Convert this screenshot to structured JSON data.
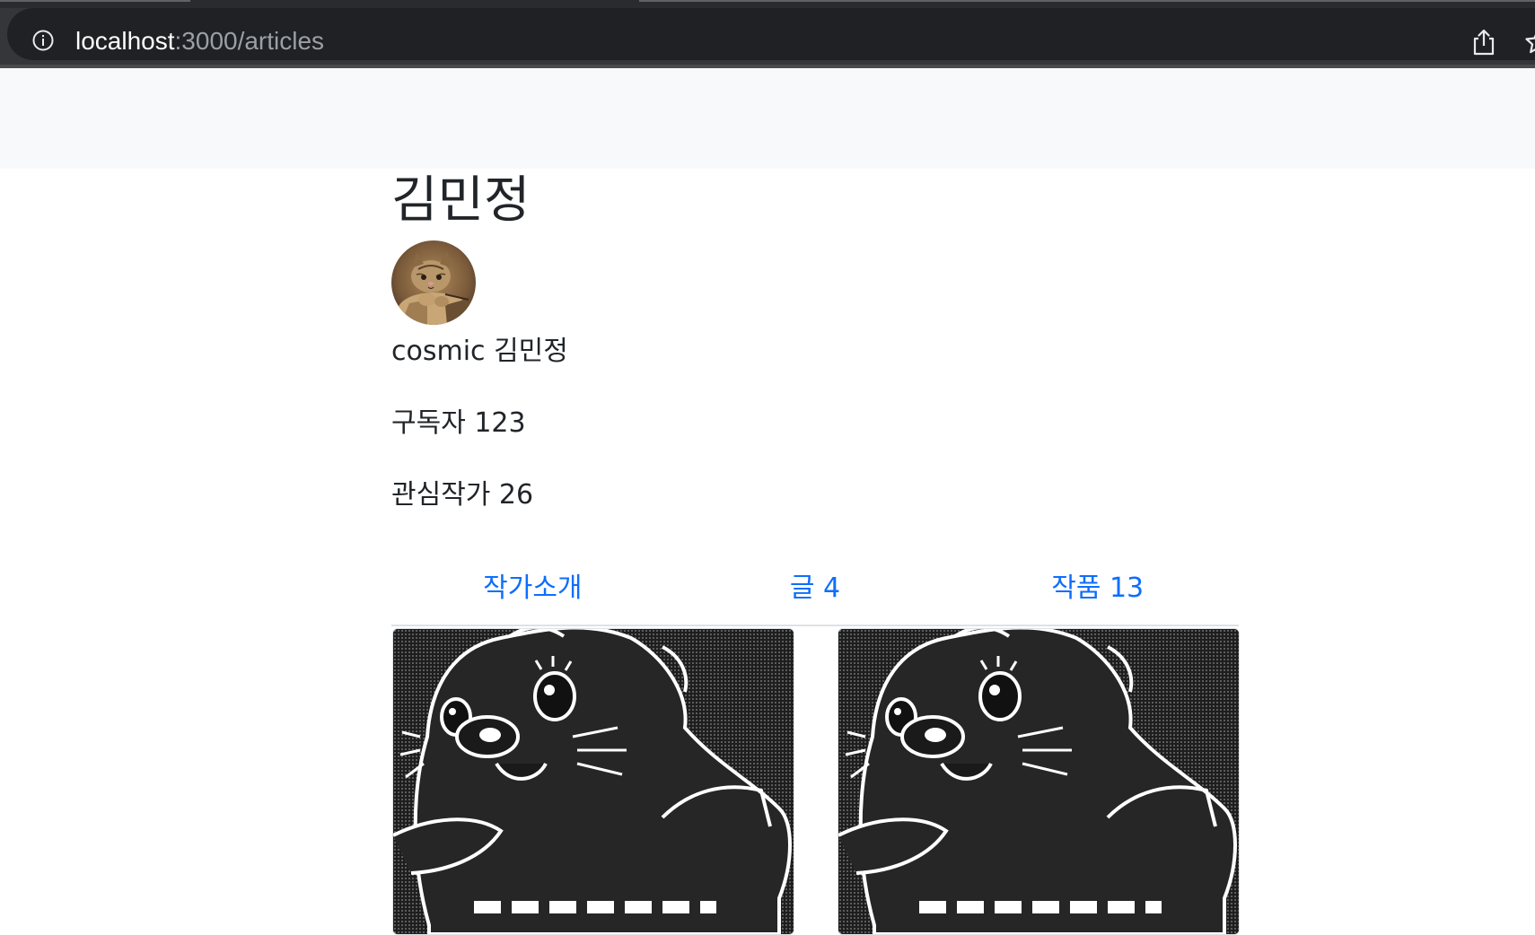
{
  "browser": {
    "url_host": "localhost",
    "url_path": ":3000/articles",
    "icons": [
      "info-icon",
      "share-icon",
      "star-icon"
    ]
  },
  "profile": {
    "name": "김민정",
    "avatar_icon": "cat-avatar",
    "description": "cosmic 김민정",
    "subscribers": "구독자 123",
    "following": "관심작가 26"
  },
  "tabs": [
    {
      "label": "작가소개"
    },
    {
      "label": "글 4"
    },
    {
      "label": "작품 13"
    }
  ],
  "colors": {
    "link": "#0d6efd",
    "navbar_bg": "#f8f9fa",
    "text": "#212529"
  }
}
